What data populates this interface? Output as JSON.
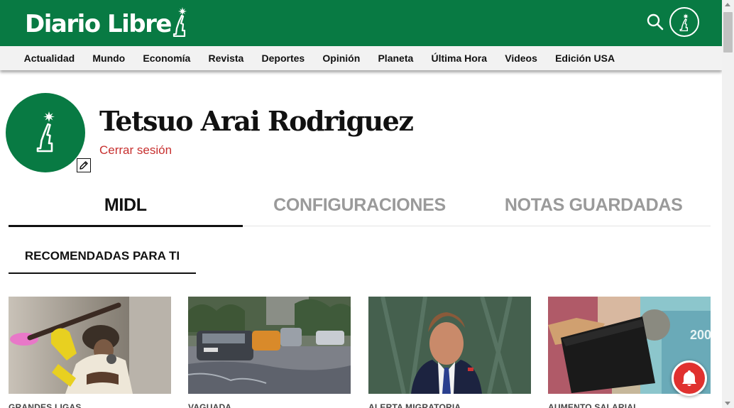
{
  "header": {
    "logo_text": "Diario Libre"
  },
  "nav": {
    "items": [
      {
        "label": "Actualidad"
      },
      {
        "label": "Mundo"
      },
      {
        "label": "Economía"
      },
      {
        "label": "Revista"
      },
      {
        "label": "Deportes"
      },
      {
        "label": "Opinión"
      },
      {
        "label": "Planeta"
      },
      {
        "label": "Última Hora"
      },
      {
        "label": "Videos"
      },
      {
        "label": "Edición USA"
      }
    ]
  },
  "profile": {
    "name": "Tetsuo Arai Rodriguez",
    "logout_label": "Cerrar sesión"
  },
  "tabs": [
    {
      "label": "MIDL",
      "active": true
    },
    {
      "label": "CONFIGURACIONES",
      "active": false
    },
    {
      "label": "NOTAS GUARDADAS",
      "active": false
    }
  ],
  "section": {
    "title": "RECOMENDADAS PARA TI"
  },
  "cards": [
    {
      "category": "GRANDES LIGAS",
      "image": "baseball-player-photo"
    },
    {
      "category": "VAGUADA",
      "image": "flooded-street-photo"
    },
    {
      "category": "ALERTA MIGRATORIA",
      "image": "speaker-at-podium-photo"
    },
    {
      "category": "AUMENTO SALARIAL",
      "image": "wallet-money-photo"
    }
  ],
  "colors": {
    "brand_green": "#087a43",
    "logout_red": "#c7302f",
    "notification_red": "#e0312f"
  },
  "icons": {
    "search": "search-icon",
    "profile": "statue-icon",
    "edit": "pencil-icon",
    "notifications": "bell-icon"
  }
}
